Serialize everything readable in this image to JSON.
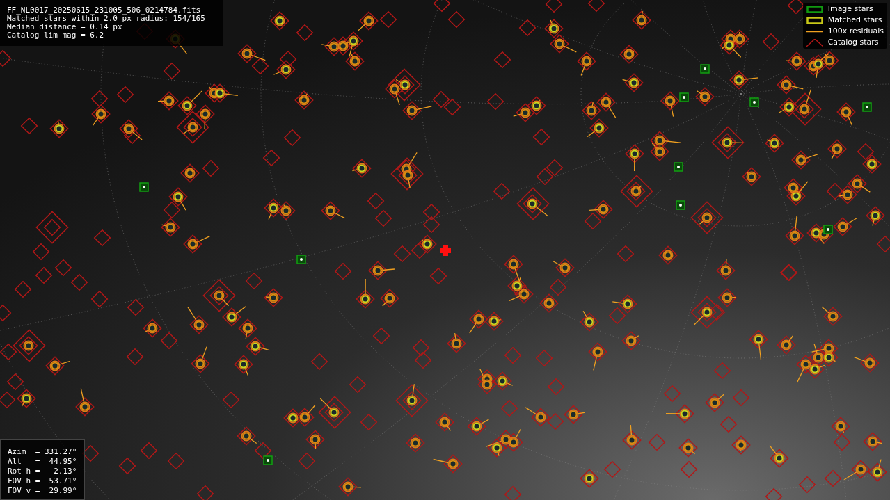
{
  "info": {
    "lines": [
      "FF_NL0017_20250615_231005_506_0214784.fits",
      "Matched stars within 2.0 px radius: 154/165",
      "Median distance = 0.14 px",
      "Catalog lim mag = 6.2"
    ]
  },
  "legend": [
    {
      "kind": "image",
      "label": "Image stars"
    },
    {
      "kind": "matched",
      "label": "Matched stars"
    },
    {
      "kind": "residual",
      "label": "100x residuals"
    },
    {
      "kind": "catalog",
      "label": "Catalog stars"
    }
  ],
  "pointing": {
    "lines": [
      "Azim  = 331.27°",
      "Alt   =  44.95°",
      "Rot h =   2.13°",
      "FOV h =  53.71°",
      "FOV v =  29.99°"
    ]
  }
}
